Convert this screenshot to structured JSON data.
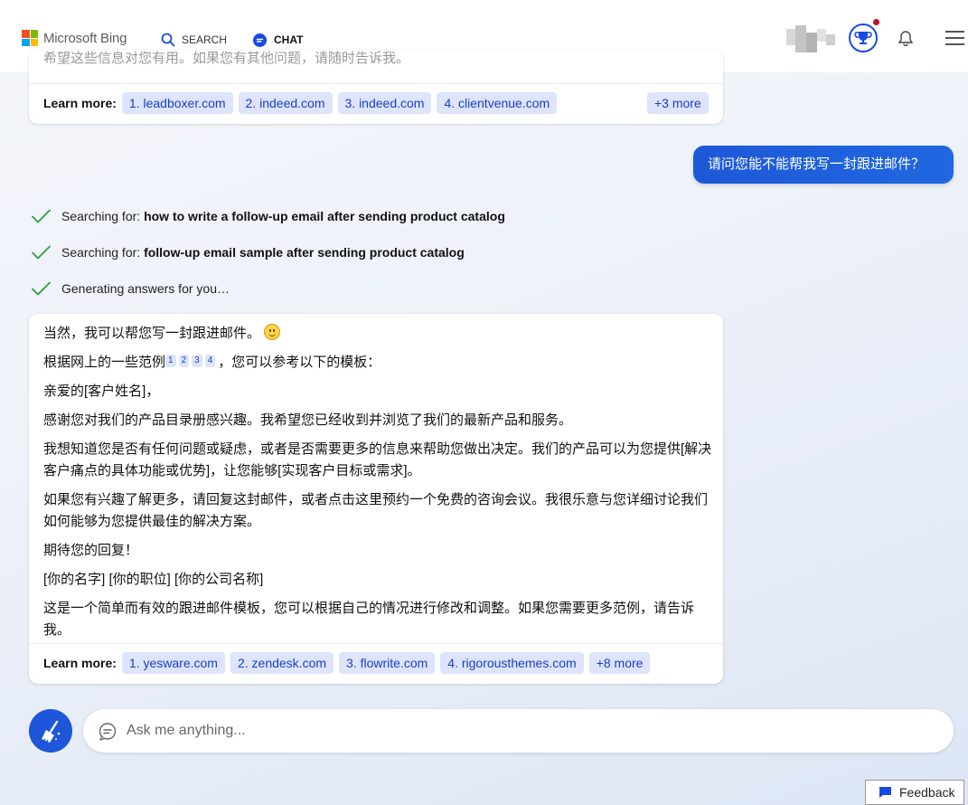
{
  "header": {
    "brand": "Microsoft Bing",
    "tabs": [
      {
        "label": "SEARCH"
      },
      {
        "label": "CHAT"
      }
    ]
  },
  "previous_card": {
    "faded_text": "希望这些信息对您有用。如果您有其他问题，请随时告诉我。",
    "learn_more_label": "Learn more:",
    "sources": [
      "1. leadboxer.com",
      "2. indeed.com",
      "3. indeed.com",
      "4. clientvenue.com"
    ],
    "more": "+3 more"
  },
  "user_message": "请问您能不能帮我写一封跟进邮件？",
  "status_lines": [
    {
      "prefix": "Searching for: ",
      "query": "how to write a follow-up email after sending product catalog"
    },
    {
      "prefix": "Searching for: ",
      "query": "follow-up email sample after sending product catalog"
    },
    {
      "prefix": "Generating answers for you…",
      "query": ""
    }
  ],
  "answer": {
    "p1": "当然，我可以帮您写一封跟进邮件。",
    "p2_before": "根据网上的一些范例",
    "citations": [
      "1",
      "2",
      "3",
      "4"
    ],
    "p2_after": "，您可以参考以下的模板：",
    "p3": "亲爱的[客户姓名]，",
    "p4": "感谢您对我们的产品目录册感兴趣。我希望您已经收到并浏览了我们的最新产品和服务。",
    "p5": "我想知道您是否有任何问题或疑虑，或者是否需要更多的信息来帮助您做出决定。我们的产品可以为您提供[解决客户痛点的具体功能或优势]，让您能够[实现客户目标或需求]。",
    "p6": "如果您有兴趣了解更多，请回复这封邮件，或者点击这里预约一个免费的咨询会议。我很乐意与您详细讨论我们如何能够为您提供最佳的解决方案。",
    "p7": "期待您的回复！",
    "p8": "[你的名字] [你的职位] [你的公司名称]",
    "p9": "这是一个简单而有效的跟进邮件模板，您可以根据自己的情况进行修改和调整。如果您需要更多范例，请告诉我。",
    "learn_more_label": "Learn more:",
    "sources": [
      "1. yesware.com",
      "2. zendesk.com",
      "3. flowrite.com",
      "4. rigorousthemes.com"
    ],
    "more": "+8 more"
  },
  "input": {
    "placeholder": "Ask me anything..."
  },
  "feedback_label": "Feedback",
  "colors": {
    "accent": "#174ae4",
    "chip_bg": "#dde4fb",
    "check": "#2e9e3e"
  }
}
